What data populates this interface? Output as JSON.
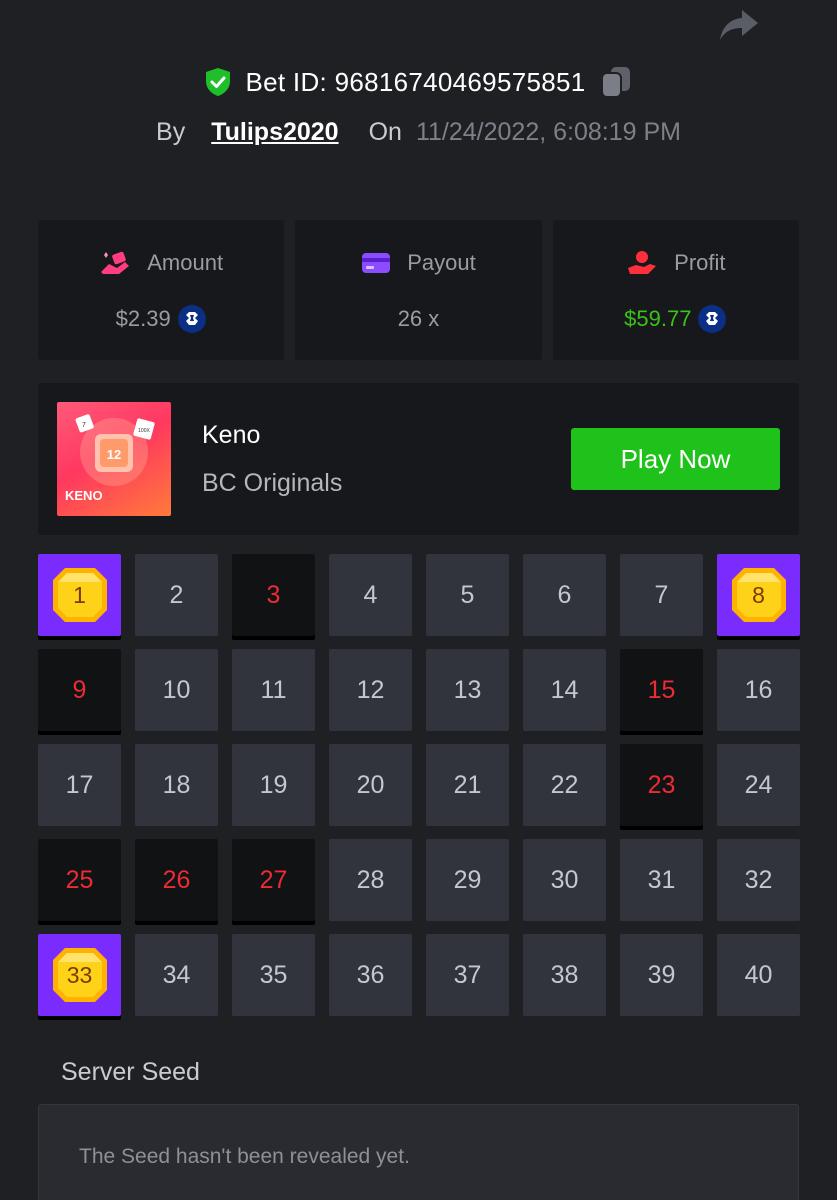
{
  "header": {
    "bet_id_label": "Bet ID: 96816740469575851",
    "by_label": "By",
    "username": "Tulips2020",
    "on_label": "On",
    "datetime": "11/24/2022, 6:08:19 PM"
  },
  "stats": {
    "amount": {
      "label": "Amount",
      "value": "$2.39"
    },
    "payout": {
      "label": "Payout",
      "value": "26 x"
    },
    "profit": {
      "label": "Profit",
      "value": "$59.77"
    }
  },
  "game": {
    "name": "Keno",
    "provider": "BC Originals",
    "play_button": "Play Now",
    "thumb_number": "12",
    "thumb_logo": "KENO",
    "thumb_die_left": "7",
    "thumb_die_right": "100X"
  },
  "grid": {
    "cells": [
      {
        "n": "1",
        "state": "hit"
      },
      {
        "n": "2",
        "state": "normal"
      },
      {
        "n": "3",
        "state": "miss"
      },
      {
        "n": "4",
        "state": "normal"
      },
      {
        "n": "5",
        "state": "normal"
      },
      {
        "n": "6",
        "state": "normal"
      },
      {
        "n": "7",
        "state": "normal"
      },
      {
        "n": "8",
        "state": "hit"
      },
      {
        "n": "9",
        "state": "miss"
      },
      {
        "n": "10",
        "state": "normal"
      },
      {
        "n": "11",
        "state": "normal"
      },
      {
        "n": "12",
        "state": "normal"
      },
      {
        "n": "13",
        "state": "normal"
      },
      {
        "n": "14",
        "state": "normal"
      },
      {
        "n": "15",
        "state": "miss"
      },
      {
        "n": "16",
        "state": "normal"
      },
      {
        "n": "17",
        "state": "normal"
      },
      {
        "n": "18",
        "state": "normal"
      },
      {
        "n": "19",
        "state": "normal"
      },
      {
        "n": "20",
        "state": "normal"
      },
      {
        "n": "21",
        "state": "normal"
      },
      {
        "n": "22",
        "state": "normal"
      },
      {
        "n": "23",
        "state": "miss"
      },
      {
        "n": "24",
        "state": "normal"
      },
      {
        "n": "25",
        "state": "miss"
      },
      {
        "n": "26",
        "state": "miss"
      },
      {
        "n": "27",
        "state": "miss"
      },
      {
        "n": "28",
        "state": "normal"
      },
      {
        "n": "29",
        "state": "normal"
      },
      {
        "n": "30",
        "state": "normal"
      },
      {
        "n": "31",
        "state": "normal"
      },
      {
        "n": "32",
        "state": "normal"
      },
      {
        "n": "33",
        "state": "hit"
      },
      {
        "n": "34",
        "state": "normal"
      },
      {
        "n": "35",
        "state": "normal"
      },
      {
        "n": "36",
        "state": "normal"
      },
      {
        "n": "37",
        "state": "normal"
      },
      {
        "n": "38",
        "state": "normal"
      },
      {
        "n": "39",
        "state": "normal"
      },
      {
        "n": "40",
        "state": "normal"
      }
    ]
  },
  "seed": {
    "label": "Server Seed",
    "message": "The Seed hasn't been revealed yet."
  },
  "icons": {
    "share": "share-arrow-icon",
    "verified": "shield-check-icon",
    "copy": "copy-icon",
    "amount": "coins-hand-icon",
    "payout": "card-icon",
    "profit": "profit-hand-icon",
    "coin": "crypto-coin-icon",
    "gem": "gem-icon"
  },
  "colors": {
    "background": "#1f2024",
    "card": "#17181b",
    "cell": "#31343c",
    "miss_text": "#ec2b33",
    "hit_bg": "#7a2cff",
    "gem": "#ffc20e",
    "play_button": "#1ec21a",
    "profit_green": "#3bc117"
  }
}
